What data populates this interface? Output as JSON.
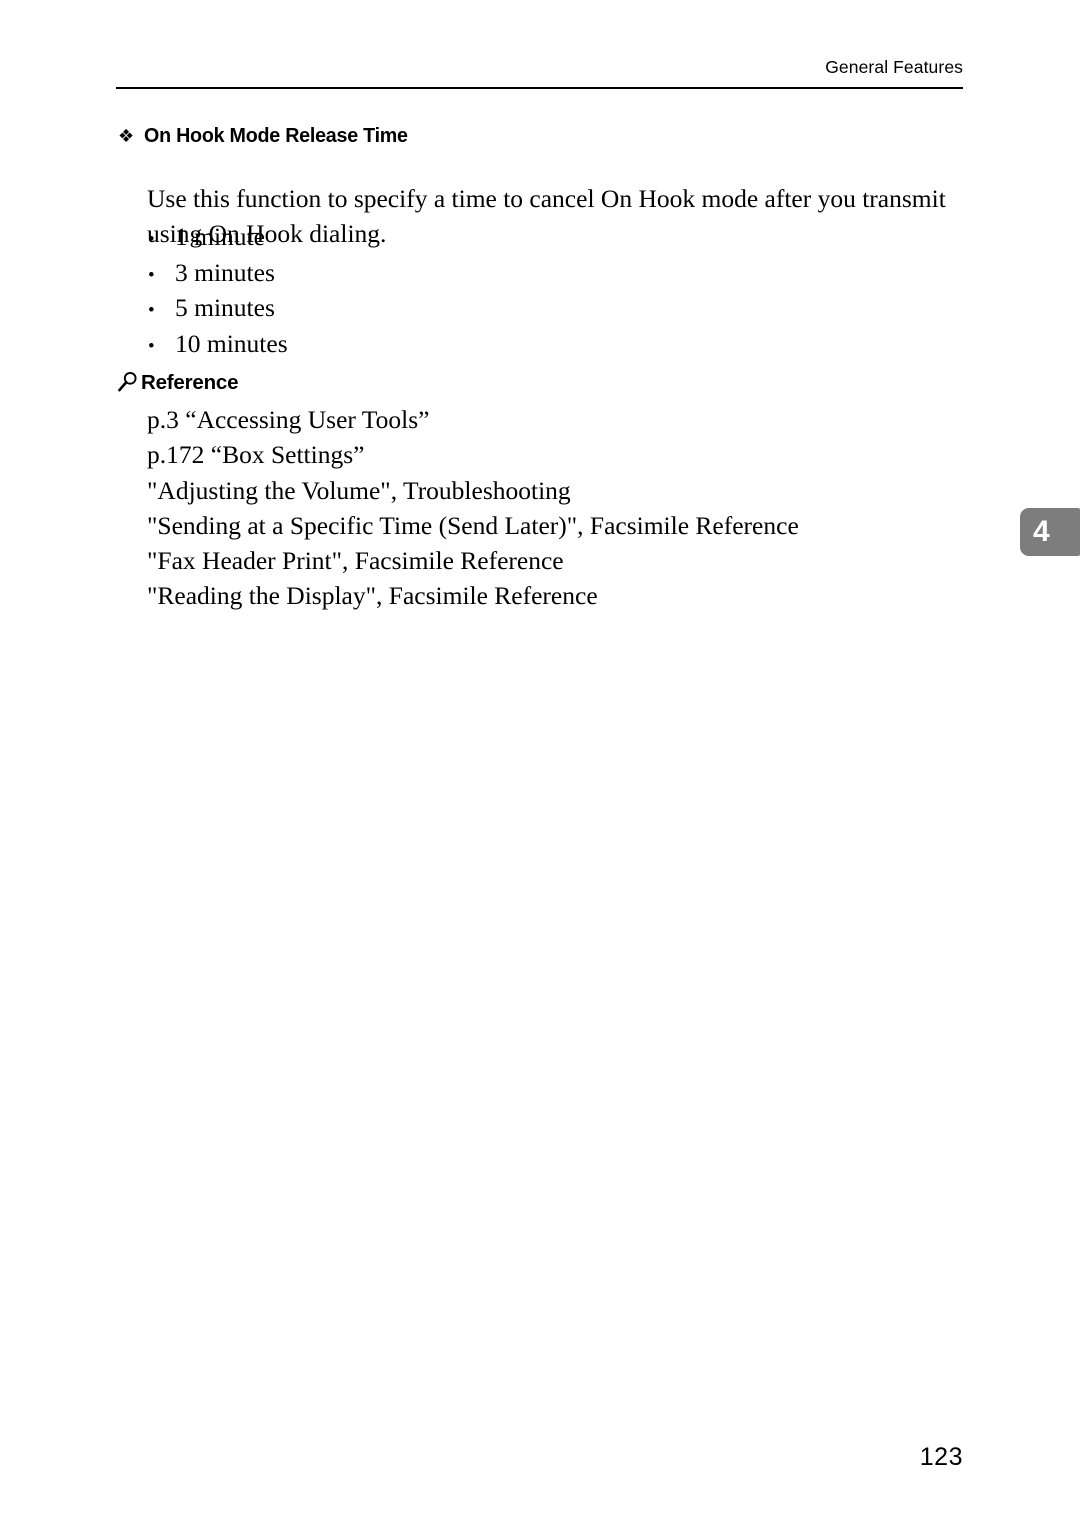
{
  "header": {
    "running_title": "General Features"
  },
  "section": {
    "bullet_glyph": "diamond-lozenge",
    "title": "On Hook Mode Release Time",
    "body": "Use this function to specify a time to cancel On Hook mode after you transmit using On Hook dialing.",
    "options": [
      {
        "label": "1 minute"
      },
      {
        "label": "3 minutes"
      },
      {
        "label": "5 minutes"
      },
      {
        "label": "10 minutes"
      }
    ]
  },
  "reference": {
    "icon": "magnifier-icon",
    "title": "Reference",
    "items": [
      {
        "text": "p.3 “Accessing User Tools”"
      },
      {
        "text": "p.172 “Box Settings”"
      },
      {
        "text": "\"Adjusting the Volume\", Troubleshooting"
      },
      {
        "text": "\"Sending at a Specific Time (Send Later)\", Facsimile Reference"
      },
      {
        "text": "\"Fax Header Print\", Facsimile Reference"
      },
      {
        "text": "\"Reading the Display\", Facsimile Reference"
      }
    ]
  },
  "chapter_tab": {
    "number": "4",
    "color": "#7d7d7d",
    "text_color": "#ffffff"
  },
  "footer": {
    "page_number": "123"
  }
}
